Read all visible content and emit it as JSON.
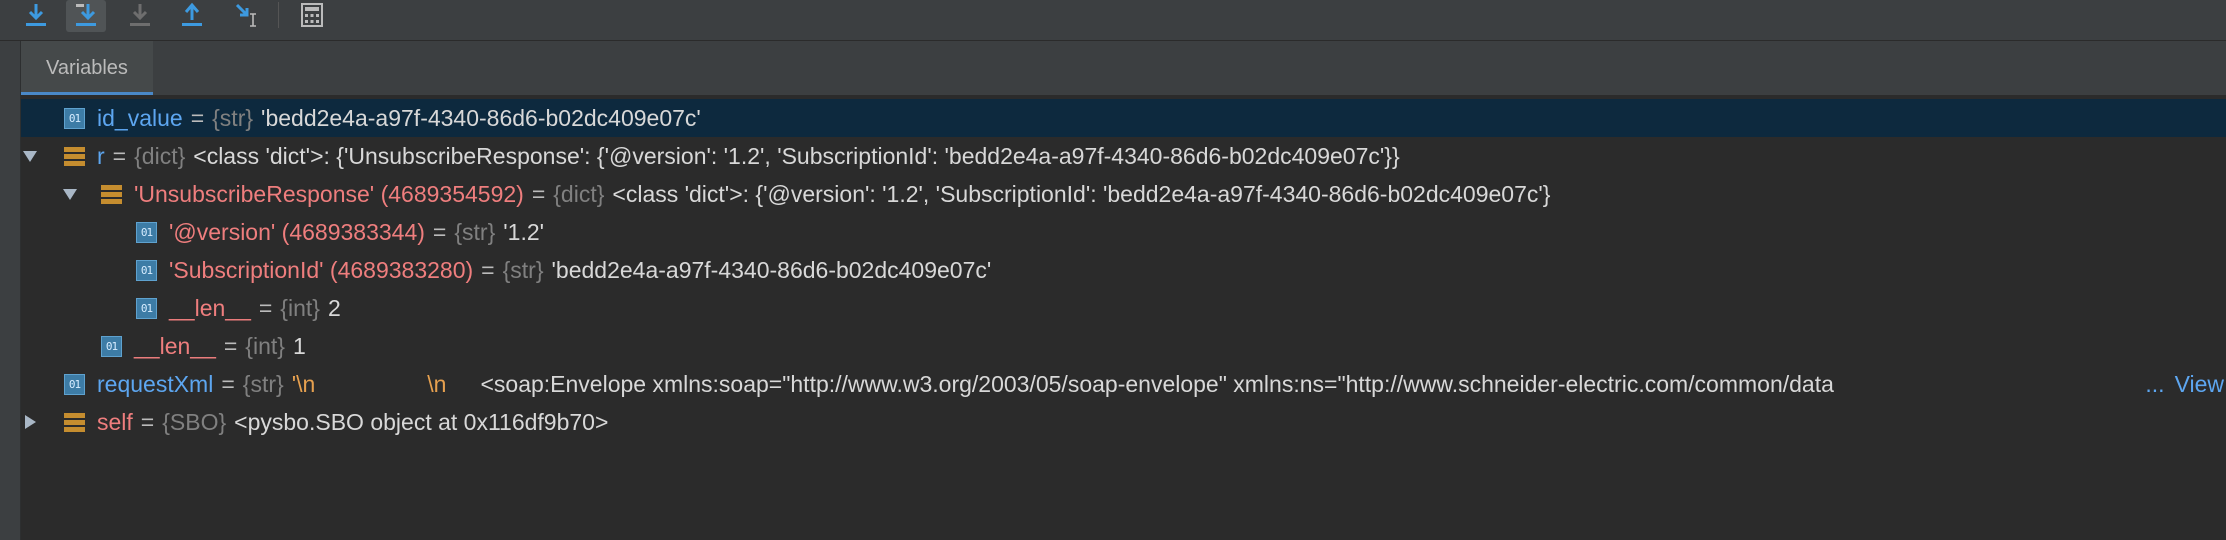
{
  "toolbar": {
    "buttons": [
      "step-over",
      "step-into",
      "step-into-my-code",
      "step-out",
      "run-to-cursor",
      "evaluate-expression"
    ]
  },
  "tabs": {
    "variables_label": "Variables"
  },
  "rows": {
    "id_value": {
      "name": "id_value",
      "eq": "=",
      "type": "{str}",
      "value": "'bedd2e4a-a97f-4340-86d6-b02dc409e07c'"
    },
    "r": {
      "name": "r",
      "eq": "=",
      "type": "{dict}",
      "value": "<class 'dict'>: {'UnsubscribeResponse': {'@version': '1.2', 'SubscriptionId': 'bedd2e4a-a97f-4340-86d6-b02dc409e07c'}}"
    },
    "unsub": {
      "name": "'UnsubscribeResponse' (4689354592)",
      "eq": "=",
      "type": "{dict}",
      "value": "<class 'dict'>: {'@version': '1.2', 'SubscriptionId': 'bedd2e4a-a97f-4340-86d6-b02dc409e07c'}"
    },
    "version": {
      "name": "'@version' (4689383344)",
      "eq": "=",
      "type": "{str}",
      "value": "'1.2'"
    },
    "subid": {
      "name": "'SubscriptionId' (4689383280)",
      "eq": "=",
      "type": "{str}",
      "value": "'bedd2e4a-a97f-4340-86d6-b02dc409e07c'"
    },
    "len_inner": {
      "name": "__len__",
      "eq": "=",
      "type": "{int}",
      "value": "2"
    },
    "len_outer": {
      "name": "__len__",
      "eq": "=",
      "type": "{int}",
      "value": "1"
    },
    "requestxml": {
      "name": "requestXml",
      "eq": "=",
      "type": "{str}",
      "value_open": "'",
      "esc1": "\\n",
      "esc2": "\\n",
      "value": "<soap:Envelope xmlns:soap=\"http://www.w3.org/2003/05/soap-envelope\" xmlns:ns=\"http://www.schneider-electric.com/common/data",
      "ellipsis": "...",
      "view_label": "View"
    },
    "self": {
      "name": "self",
      "eq": "=",
      "type": "{SBO}",
      "value": "<pysbo.SBO object at 0x116df9b70>"
    }
  },
  "colors": {
    "selection": "#0d293e",
    "name_blue": "#5da6f0",
    "name_red": "#ef7e7e",
    "accent": "#4a88c7"
  }
}
